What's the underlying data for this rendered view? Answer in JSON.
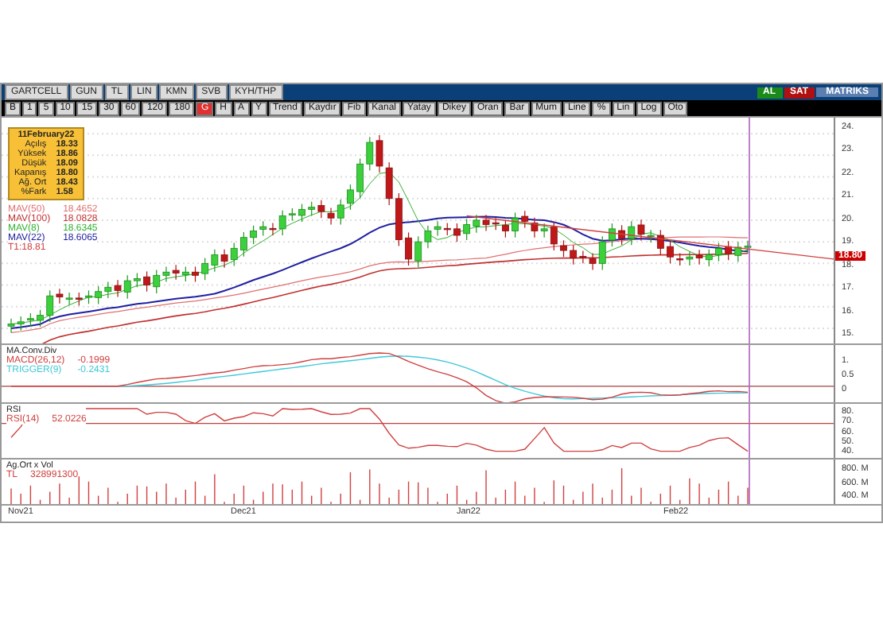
{
  "toolbar": {
    "symbol": "GARTCELL",
    "fields": [
      "GUN",
      "TL",
      "LIN",
      "KMN",
      "SVB",
      "KYH/THP"
    ],
    "periods": [
      {
        "label": "B",
        "selected": false
      },
      {
        "label": "1",
        "selected": false
      },
      {
        "label": "5",
        "selected": false
      },
      {
        "label": "10",
        "selected": false
      },
      {
        "label": "15",
        "selected": false
      },
      {
        "label": "30",
        "selected": false
      },
      {
        "label": "60",
        "selected": false
      },
      {
        "label": "120",
        "selected": false
      },
      {
        "label": "180",
        "selected": false
      },
      {
        "label": "G",
        "selected": true
      },
      {
        "label": "H",
        "selected": false
      },
      {
        "label": "A",
        "selected": false
      },
      {
        "label": "Y",
        "selected": false
      }
    ],
    "tools": [
      "Trend",
      "Kaydır",
      "Fib",
      "Kanal",
      "Yatay",
      "Dikey",
      "Oran",
      "Bar",
      "Mum",
      "Line",
      "%",
      "Lin",
      "Log",
      "Oto"
    ],
    "trade_buttons": [
      {
        "label": "AL",
        "kind": "buy"
      },
      {
        "label": "SAT",
        "kind": "sell"
      }
    ],
    "brand": "MATRIKS"
  },
  "legend": {
    "date": "11February22",
    "rows": [
      {
        "label": "Açılış",
        "value": "18.33"
      },
      {
        "label": "Yüksek",
        "value": "18.86"
      },
      {
        "label": "Düşük",
        "value": "18.09"
      },
      {
        "label": "Kapanış",
        "value": "18.80"
      },
      {
        "label": "Ağ. Ort",
        "value": "18.43"
      },
      {
        "label": "%Fark",
        "value": "1.58"
      }
    ]
  },
  "indicators": [
    {
      "label": "MAV(50)",
      "value": "18.4652",
      "color": "#e07070"
    },
    {
      "label": "MAV(100)",
      "value": "18.0828",
      "color": "#c03030"
    },
    {
      "label": "MAV(8)",
      "value": "18.6345",
      "color": "#30b030"
    },
    {
      "label": "MAV(22)",
      "value": "18.6065",
      "color": "#2020a0"
    },
    {
      "label": "T1:18.81",
      "color": "#d04040"
    }
  ],
  "price_axis": {
    "ticks": [
      "24.",
      "23.",
      "22.",
      "21.",
      "20.",
      "19.",
      "18.",
      "17.",
      "16.",
      "15."
    ],
    "last_price": "18.80"
  },
  "panes": [
    {
      "title": "MA.Conv.Div",
      "lines": [
        {
          "label": "MACD(26,12)",
          "value": "-0.1999",
          "color": "#d04040"
        },
        {
          "label": "TRIGGER(9)",
          "value": "-0.2431",
          "color": "#40c8d8"
        }
      ],
      "ticks": [
        "1.",
        "0.5",
        "0"
      ]
    },
    {
      "title": "RSI",
      "lines": [
        {
          "label": "RSI(14)",
          "value": "52.0226",
          "color": "#d04040"
        }
      ],
      "ticks": [
        "80.",
        "70.",
        "60.",
        "50.",
        "40."
      ]
    },
    {
      "title": "Ag.Ort x Vol",
      "lines": [
        {
          "label": "TL",
          "value": "328991300",
          "color": "#d04040"
        }
      ],
      "ticks": [
        "800. M",
        "600. M",
        "400. M"
      ]
    }
  ],
  "dates": [
    "Nov21",
    "Dec21",
    "Jan22",
    "Feb22"
  ]
}
